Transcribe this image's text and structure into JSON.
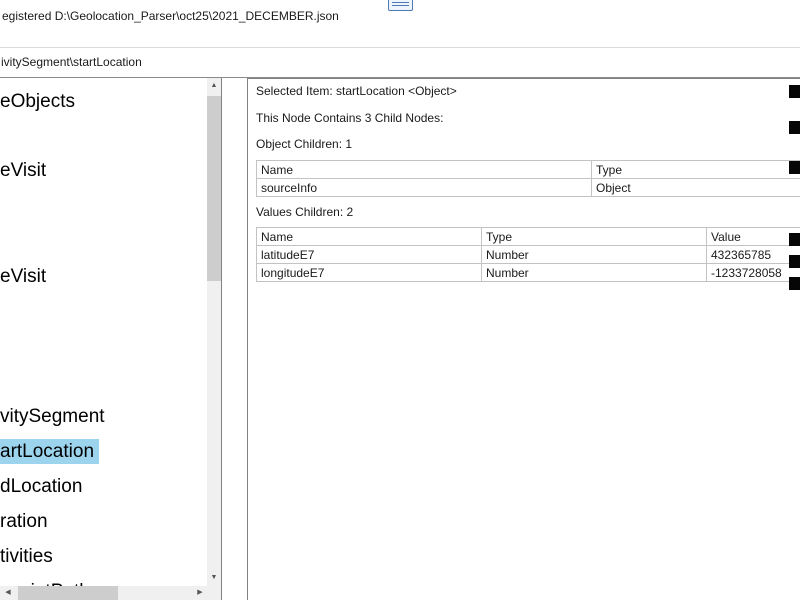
{
  "titlebar": {
    "path_text": "egistered D:\\Geolocation_Parser\\oct25\\2021_DECEMBER.json"
  },
  "breadcrumb": {
    "path": "ivitySegment\\startLocation"
  },
  "tree": {
    "items": [
      {
        "label": "eObjects",
        "selected": false
      },
      {
        "label": "eVisit",
        "selected": false
      },
      {
        "label": "eVisit",
        "selected": false
      },
      {
        "label": "vitySegment",
        "selected": false
      },
      {
        "label": "artLocation",
        "selected": true
      },
      {
        "label": "dLocation",
        "selected": false
      },
      {
        "label": "ration",
        "selected": false
      },
      {
        "label": "tivities",
        "selected": false
      },
      {
        "label": "ypointPath",
        "selected": false
      }
    ]
  },
  "details": {
    "selected_item": "Selected Item: startLocation <Object>",
    "node_summary": "This Node Contains 3 Child Nodes:",
    "object_children_label": "Object Children: 1",
    "object_table": {
      "headers": [
        "Name",
        "Type"
      ],
      "rows": [
        [
          "sourceInfo",
          "Object"
        ]
      ]
    },
    "values_children_label": "Values Children: 2",
    "values_table": {
      "headers": [
        "Name",
        "Type",
        "Value"
      ],
      "rows": [
        [
          "latitudeE7",
          "Number",
          "432365785"
        ],
        [
          "longitudeE7",
          "Number",
          "-1233728058"
        ]
      ]
    }
  },
  "colors": {
    "selection_highlight": "#9cd4ee",
    "panel_border": "#828282",
    "table_border": "#c3c3c3",
    "scrollbar_track": "#f0f0f0",
    "scrollbar_thumb": "#cdcdcd",
    "icon_blue": "#4d7ab5"
  }
}
